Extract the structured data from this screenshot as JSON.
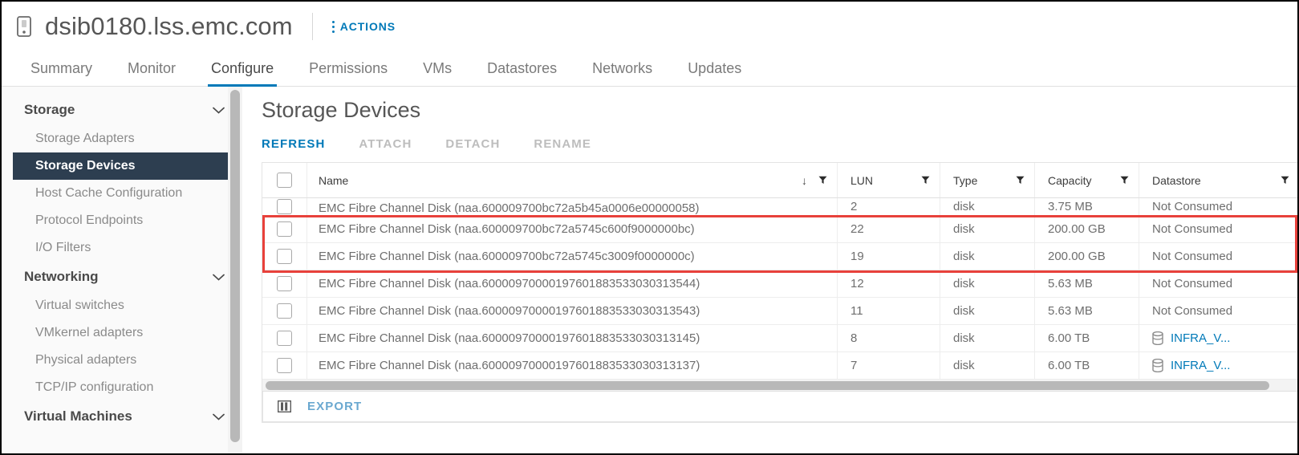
{
  "header": {
    "host_icon": "host-icon",
    "title": "dsib0180.lss.emc.com",
    "actions_label": "ACTIONS"
  },
  "tabs": [
    {
      "label": "Summary",
      "active": false
    },
    {
      "label": "Monitor",
      "active": false
    },
    {
      "label": "Configure",
      "active": true
    },
    {
      "label": "Permissions",
      "active": false
    },
    {
      "label": "VMs",
      "active": false
    },
    {
      "label": "Datastores",
      "active": false
    },
    {
      "label": "Networks",
      "active": false
    },
    {
      "label": "Updates",
      "active": false
    }
  ],
  "sidebar": {
    "groups": [
      {
        "label": "Storage",
        "items": [
          {
            "label": "Storage Adapters",
            "selected": false
          },
          {
            "label": "Storage Devices",
            "selected": true
          },
          {
            "label": "Host Cache Configuration",
            "selected": false
          },
          {
            "label": "Protocol Endpoints",
            "selected": false
          },
          {
            "label": "I/O Filters",
            "selected": false
          }
        ]
      },
      {
        "label": "Networking",
        "items": [
          {
            "label": "Virtual switches",
            "selected": false
          },
          {
            "label": "VMkernel adapters",
            "selected": false
          },
          {
            "label": "Physical adapters",
            "selected": false
          },
          {
            "label": "TCP/IP configuration",
            "selected": false
          }
        ]
      },
      {
        "label": "Virtual Machines",
        "items": []
      }
    ]
  },
  "main": {
    "title": "Storage Devices",
    "toolbar": [
      {
        "label": "REFRESH",
        "enabled": true
      },
      {
        "label": "ATTACH",
        "enabled": false
      },
      {
        "label": "DETACH",
        "enabled": false
      },
      {
        "label": "RENAME",
        "enabled": false
      }
    ],
    "table": {
      "columns": [
        {
          "label": "Name",
          "sorted": "descending"
        },
        {
          "label": "LUN"
        },
        {
          "label": "Type"
        },
        {
          "label": "Capacity"
        },
        {
          "label": "Datastore"
        }
      ],
      "rows": [
        {
          "name": "EMC Fibre Channel Disk (naa.600009700bc72a5b45a0006e00000058)",
          "lun": "2",
          "type": "disk",
          "capacity": "3.75 MB",
          "datastore": "Not Consumed",
          "datastore_is_link": false,
          "highlighted": false,
          "clipped": true
        },
        {
          "name": "EMC Fibre Channel Disk (naa.600009700bc72a5745c600f9000000bc)",
          "lun": "22",
          "type": "disk",
          "capacity": "200.00 GB",
          "datastore": "Not Consumed",
          "datastore_is_link": false,
          "highlighted": true,
          "clipped": false
        },
        {
          "name": "EMC Fibre Channel Disk (naa.600009700bc72a5745c3009f0000000c)",
          "lun": "19",
          "type": "disk",
          "capacity": "200.00 GB",
          "datastore": "Not Consumed",
          "datastore_is_link": false,
          "highlighted": true,
          "clipped": false
        },
        {
          "name": "EMC Fibre Channel Disk (naa.60000970000197601883533030313544)",
          "lun": "12",
          "type": "disk",
          "capacity": "5.63 MB",
          "datastore": "Not Consumed",
          "datastore_is_link": false,
          "highlighted": false,
          "clipped": false
        },
        {
          "name": "EMC Fibre Channel Disk (naa.60000970000197601883533030313543)",
          "lun": "11",
          "type": "disk",
          "capacity": "5.63 MB",
          "datastore": "Not Consumed",
          "datastore_is_link": false,
          "highlighted": false,
          "clipped": false
        },
        {
          "name": "EMC Fibre Channel Disk (naa.60000970000197601883533030313145)",
          "lun": "8",
          "type": "disk",
          "capacity": "6.00 TB",
          "datastore": "INFRA_V...",
          "datastore_is_link": true,
          "highlighted": false,
          "clipped": false
        },
        {
          "name": "EMC Fibre Channel Disk (naa.60000970000197601883533030313137)",
          "lun": "7",
          "type": "disk",
          "capacity": "6.00 TB",
          "datastore": "INFRA_V...",
          "datastore_is_link": true,
          "highlighted": false,
          "clipped": false
        }
      ],
      "footer": {
        "export_label": "EXPORT"
      }
    }
  },
  "colors": {
    "accent_blue": "#0079b8",
    "selected_nav_bg": "#2d3e50",
    "highlight_red": "#e8413b",
    "disabled_gray": "#bdbdbd"
  }
}
